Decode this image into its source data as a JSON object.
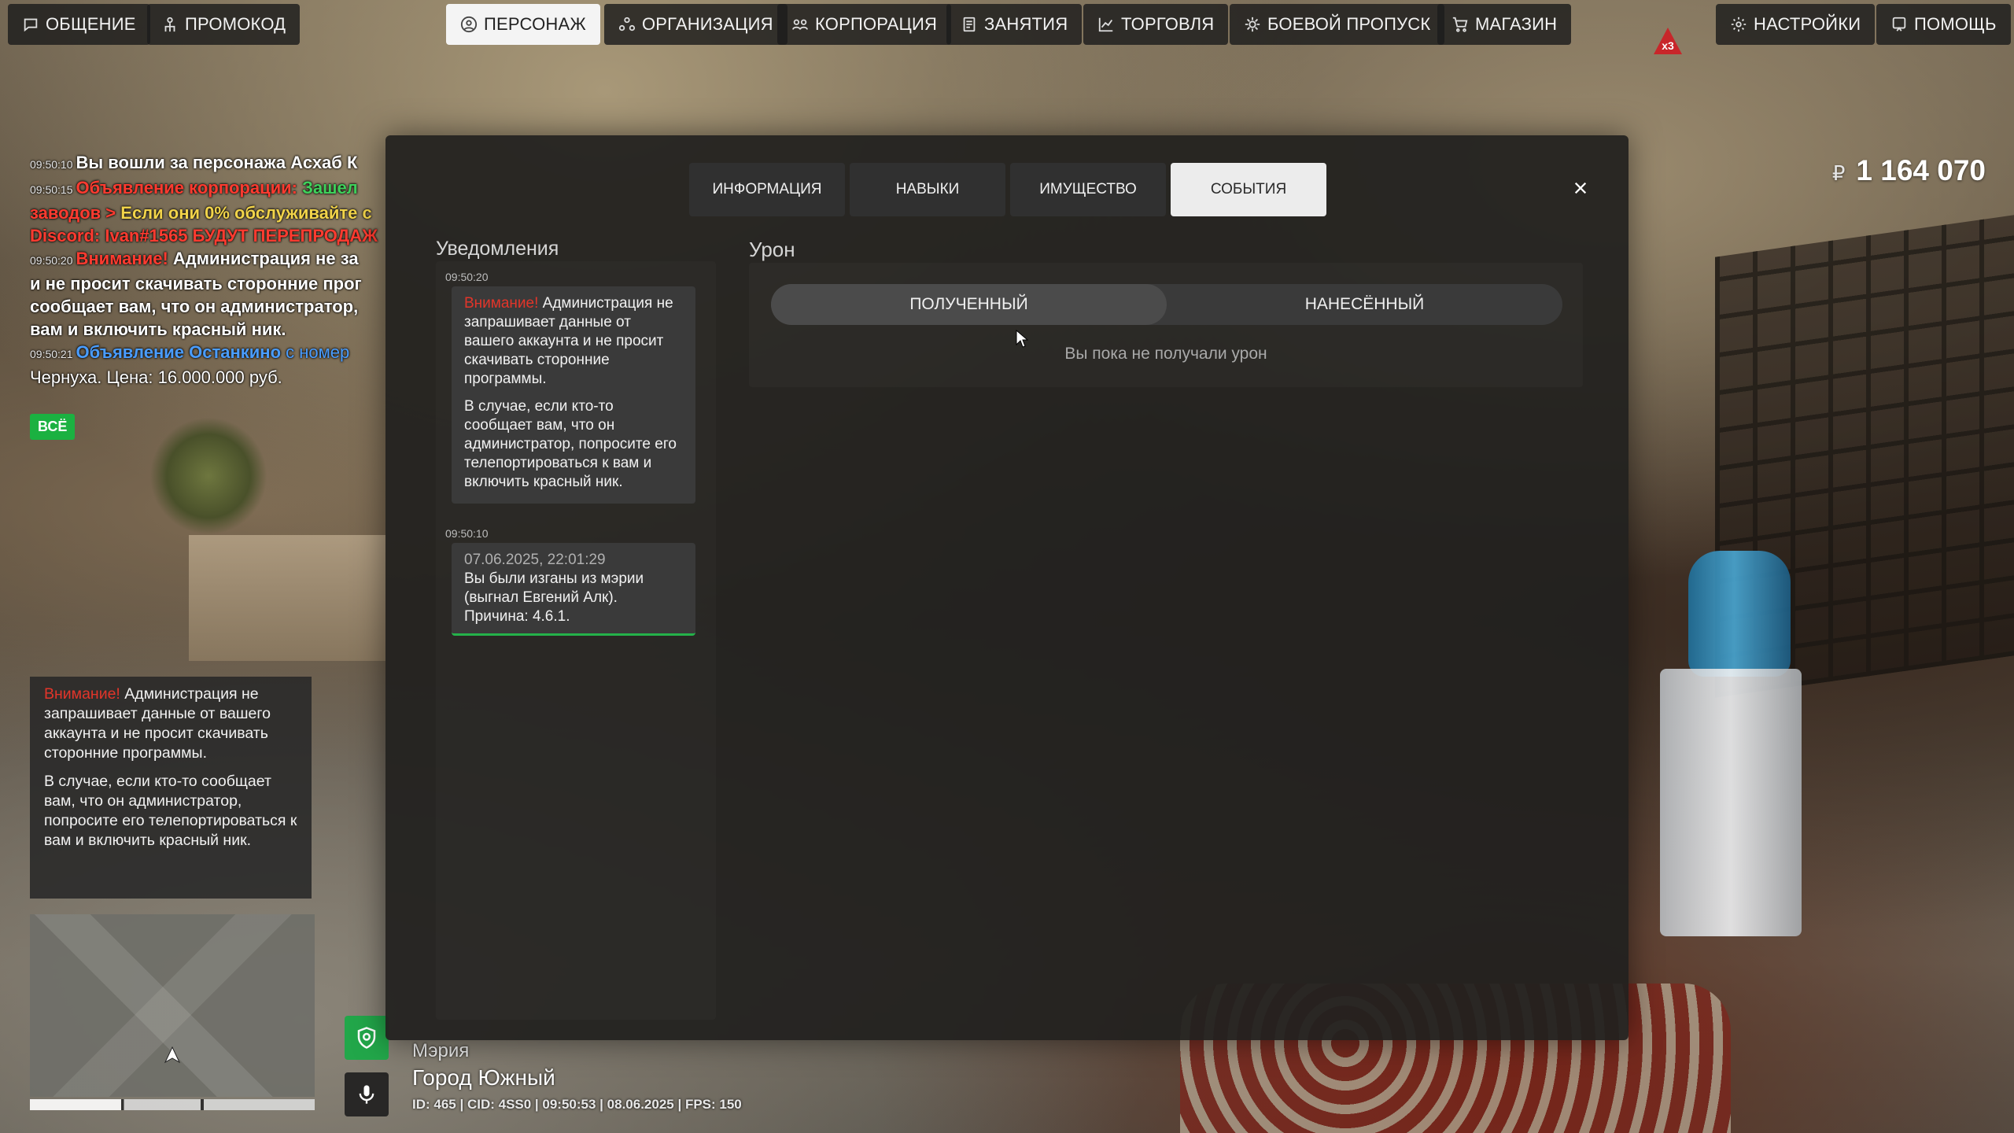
{
  "nav": {
    "items": [
      {
        "label": "ОБЩЕНИЕ",
        "icon": "chat-icon"
      },
      {
        "label": "ПРОМОКОД",
        "icon": "person-gift-icon"
      },
      {
        "label": "ПЕРСОНАЖ",
        "icon": "user-icon",
        "active": true
      },
      {
        "label": "ОРГАНИЗАЦИЯ",
        "icon": "organization-icon"
      },
      {
        "label": "КОРПОРАЦИЯ",
        "icon": "group-icon"
      },
      {
        "label": "ЗАНЯТИЯ",
        "icon": "clipboard-icon"
      },
      {
        "label": "ТОРГОВЛЯ",
        "icon": "chart-icon"
      },
      {
        "label": "БОЕВОЙ ПРОПУСК",
        "icon": "gear-star-icon"
      },
      {
        "label": "МАГАЗИН",
        "icon": "cart-icon"
      }
    ],
    "right": [
      {
        "label": "НАСТРОЙКИ",
        "icon": "settings-icon"
      },
      {
        "label": "ПОМОЩЬ",
        "icon": "help-icon"
      }
    ],
    "xp_badge": "x3"
  },
  "balance": {
    "currency": "₽",
    "amount": "1 164 070"
  },
  "chat": {
    "lines": [
      {
        "ts": "09:50:10",
        "parts": [
          {
            "t": "Вы вошли за персонажа Асхаб К",
            "c": "white"
          }
        ]
      },
      {
        "ts": "09:50:15",
        "parts": [
          {
            "t": "Объявление корпорации: ",
            "c": "red"
          },
          {
            "t": "Зашел",
            "c": "green"
          }
        ]
      },
      {
        "ts": "",
        "parts": [
          {
            "t": "заводов > ",
            "c": "red"
          },
          {
            "t": "Если они 0% обслуживайте с",
            "c": "yellow"
          }
        ]
      },
      {
        "ts": "",
        "parts": [
          {
            "t": "Discord: Ivan#1565 БУДУТ ПЕРЕПРОДАЖ",
            "c": "red"
          }
        ]
      },
      {
        "ts": "09:50:20",
        "parts": [
          {
            "t": "Внимание! ",
            "c": "red"
          },
          {
            "t": "Администрация не за",
            "c": "white"
          }
        ]
      },
      {
        "ts": "",
        "parts": [
          {
            "t": "и не просит скачивать сторонние прог",
            "c": "white"
          }
        ]
      },
      {
        "ts": "",
        "parts": [
          {
            "t": "сообщает вам, что он администратор,",
            "c": "white"
          }
        ]
      },
      {
        "ts": "",
        "parts": [
          {
            "t": "вам и включить красный ник.",
            "c": "white"
          }
        ]
      },
      {
        "ts": "09:50:21",
        "parts": [
          {
            "t": "Объявление Останкино ",
            "c": "blue"
          },
          {
            "t": "с номер",
            "c": "blue"
          }
        ]
      },
      {
        "ts": "",
        "parts": [
          {
            "t": "Чернуха. Цена: 16.000.000 руб.",
            "c": "white"
          }
        ]
      }
    ],
    "all_label": "ВСЁ"
  },
  "left_notice": {
    "warn": "Внимание!",
    "p1": " Администрация не запрашивает данные от вашего аккаунта и не просит скачивать сторонние программы.",
    "p2": "В случае, если кто-то сообщает вам, что он администратор, попросите его телепортироваться к вам и включить красный ник."
  },
  "location": {
    "building": "Мэрия",
    "city": "Город Южный",
    "meta": "ID: 465 | CID: 4SS0 | 09:50:53 | 08.06.2025 | FPS: 150"
  },
  "modal": {
    "tabs": [
      {
        "label": "ИНФОРМАЦИЯ"
      },
      {
        "label": "НАВЫКИ"
      },
      {
        "label": "ИМУЩЕСТВО"
      },
      {
        "label": "СОБЫТИЯ",
        "active": true
      }
    ],
    "close": "×",
    "notifications": {
      "title": "Уведомления",
      "items": [
        {
          "ts": "09:50:20",
          "warn": "Внимание!",
          "p1": " Администрация не запрашивает данные от вашего аккаунта и не просит скачивать сторонние программы.",
          "p2": "В случае, если кто-то сообщает вам, что он администратор, попросите его телепортироваться к вам и включить красный ник."
        },
        {
          "ts": "09:50:10",
          "date": "07.06.2025, 22:01:29",
          "text": "Вы были изганы из мэрии (выгнал Евгений Алк). Причина: 4.6.1."
        }
      ]
    },
    "damage": {
      "title": "Урон",
      "received_label": "ПОЛУЧЕННЫЙ",
      "dealt_label": "НАНЕСЁННЫЙ",
      "empty": "Вы пока не получали урон"
    }
  }
}
